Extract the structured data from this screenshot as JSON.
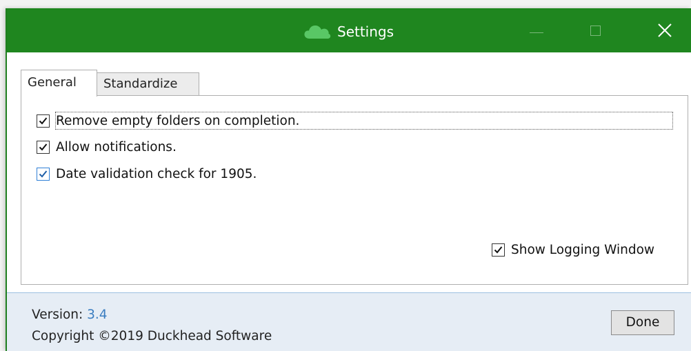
{
  "window": {
    "title": "Settings",
    "app_icon": "cloud-icon",
    "accent_color": "#1f861f"
  },
  "tabs": [
    {
      "label": "General",
      "selected": true
    },
    {
      "label": "Standardize",
      "selected": false
    }
  ],
  "options": [
    {
      "label": "Remove empty folders on completion.",
      "checked": true
    },
    {
      "label": "Allow notifications.",
      "checked": true
    },
    {
      "label": "Date validation check for 1905.",
      "checked": true
    }
  ],
  "logging": {
    "label": "Show Logging Window",
    "checked": true
  },
  "footer": {
    "version_label": "Version:",
    "version_value": "3.4",
    "copyright": "Copyright ©2019 Duckhead Software",
    "done_label": "Done"
  }
}
